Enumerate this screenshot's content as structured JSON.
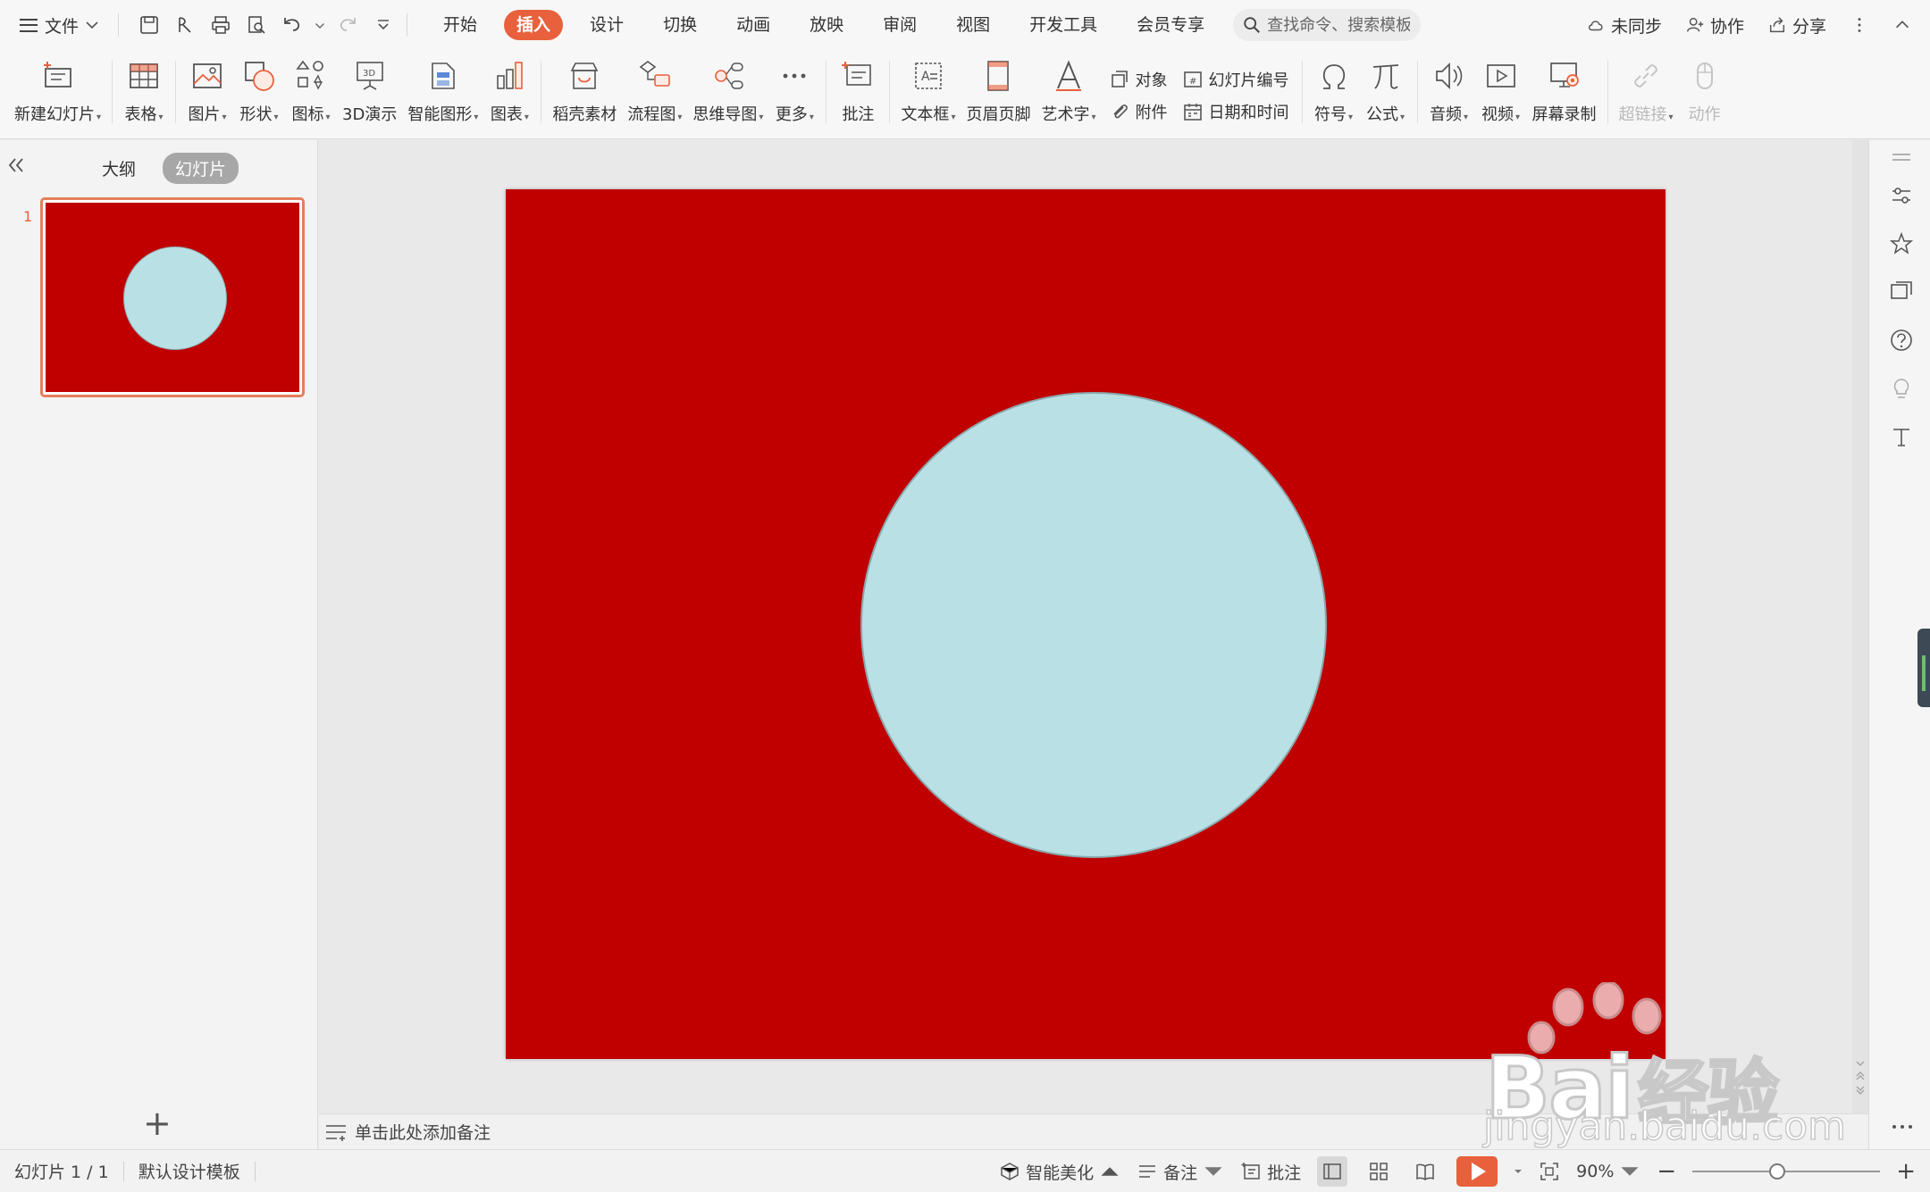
{
  "menubar": {
    "file_label": "文件",
    "tabs": [
      {
        "label": "开始",
        "active": false
      },
      {
        "label": "插入",
        "active": true
      },
      {
        "label": "设计",
        "active": false
      },
      {
        "label": "切换",
        "active": false
      },
      {
        "label": "动画",
        "active": false
      },
      {
        "label": "放映",
        "active": false
      },
      {
        "label": "审阅",
        "active": false
      },
      {
        "label": "视图",
        "active": false
      },
      {
        "label": "开发工具",
        "active": false
      },
      {
        "label": "会员专享",
        "active": false
      }
    ],
    "search_placeholder": "查找命令、搜索模板",
    "sync_label": "未同步",
    "collab_label": "协作",
    "share_label": "分享"
  },
  "ribbon": {
    "new_slide": "新建幻灯片",
    "table": "表格",
    "picture": "图片",
    "shape": "形状",
    "icon": "图标",
    "demo3d": "3D演示",
    "smartart": "智能图形",
    "chart": "图表",
    "daoke": "稻壳素材",
    "flowchart": "流程图",
    "mindmap": "思维导图",
    "more": "更多",
    "comment": "批注",
    "textbox": "文本框",
    "header_footer": "页眉页脚",
    "wordart": "艺术字",
    "object": "对象",
    "slide_number": "幻灯片编号",
    "attachment": "附件",
    "datetime": "日期和时间",
    "symbol": "符号",
    "formula": "公式",
    "audio": "音频",
    "video": "视频",
    "screen_record": "屏幕录制",
    "hyperlink": "超链接",
    "action": "动作"
  },
  "leftpanel": {
    "outline_tab": "大纲",
    "slides_tab": "幻灯片",
    "slide_number": "1",
    "add_symbol": "+"
  },
  "notes": {
    "placeholder": "单击此处添加备注"
  },
  "statusbar": {
    "slide_count": "幻灯片 1 / 1",
    "template": "默认设计模板",
    "beautify": "智能美化",
    "notes": "备注",
    "comments": "批注",
    "zoom": "90%"
  },
  "watermark": {
    "brand": "Bai",
    "brand2": "经验",
    "url": "jingyan.baidu.com"
  },
  "colors": {
    "accent": "#e8603c",
    "slide_bg": "#c00000",
    "circle_fill": "#b9e0e4",
    "circle_stroke": "#8aa8ad"
  },
  "controls": {
    "zoom_slider_value": 0.45
  }
}
